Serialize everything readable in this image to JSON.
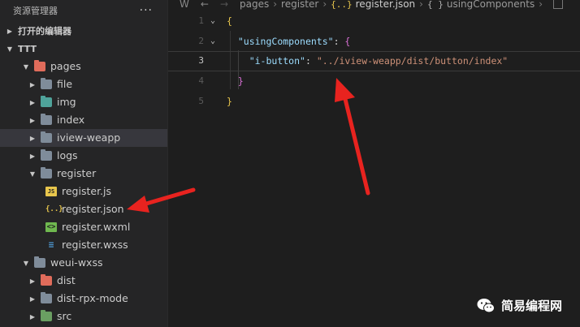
{
  "sidebar": {
    "title": "资源管理器",
    "more_label": "···",
    "open_editors_label": "打开的编辑器",
    "project_label": "TTT"
  },
  "tree": [
    {
      "label": "pages",
      "indent": 1,
      "expanded": true,
      "kind": "folder",
      "icon": "folder-red-icon"
    },
    {
      "label": "file",
      "indent": 2,
      "expanded": false,
      "kind": "folder",
      "icon": "folder-icon"
    },
    {
      "label": "img",
      "indent": 2,
      "expanded": false,
      "kind": "folder",
      "icon": "folder-teal-icon"
    },
    {
      "label": "index",
      "indent": 2,
      "expanded": false,
      "kind": "folder",
      "icon": "folder-icon"
    },
    {
      "label": "iview-weapp",
      "indent": 2,
      "expanded": false,
      "kind": "folder",
      "icon": "folder-icon",
      "selected": true
    },
    {
      "label": "logs",
      "indent": 2,
      "expanded": false,
      "kind": "folder",
      "icon": "folder-icon"
    },
    {
      "label": "register",
      "indent": 2,
      "expanded": true,
      "kind": "folder",
      "icon": "folder-icon"
    },
    {
      "label": "register.js",
      "indent": 3,
      "kind": "file",
      "icon": "js-file-icon",
      "glyph": "JS"
    },
    {
      "label": "register.json",
      "indent": 3,
      "kind": "file",
      "icon": "json-file-icon",
      "glyph": "{..}"
    },
    {
      "label": "register.wxml",
      "indent": 3,
      "kind": "file",
      "icon": "wxml-file-icon",
      "glyph": "<>"
    },
    {
      "label": "register.wxss",
      "indent": 3,
      "kind": "file",
      "icon": "wxss-file-icon",
      "glyph": "≡"
    },
    {
      "label": "weui-wxss",
      "indent": 1,
      "expanded": true,
      "kind": "folder",
      "icon": "folder-icon"
    },
    {
      "label": "dist",
      "indent": 2,
      "expanded": false,
      "kind": "folder",
      "icon": "folder-red-icon"
    },
    {
      "label": "dist-rpx-mode",
      "indent": 2,
      "expanded": false,
      "kind": "folder",
      "icon": "folder-icon"
    },
    {
      "label": "src",
      "indent": 2,
      "expanded": false,
      "kind": "folder",
      "icon": "folder-green-icon"
    }
  ],
  "breadcrumb": {
    "parts": [
      "pages",
      "register",
      "register.json",
      "usingComponents"
    ],
    "json_glyph": "{..}",
    "object_glyph": "{ }"
  },
  "code": {
    "lines": [
      {
        "n": "1",
        "fold": "⌄",
        "tokens": [
          {
            "t": "{",
            "c": "p-brace"
          }
        ]
      },
      {
        "n": "2",
        "fold": "⌄",
        "tokens": [
          {
            "t": "  "
          },
          {
            "t": "\"usingComponents\"",
            "c": "p-key"
          },
          {
            "t": ": ",
            "c": "p-punct"
          },
          {
            "t": "{",
            "c": "p-pink"
          }
        ]
      },
      {
        "n": "3",
        "fold": "",
        "active": true,
        "tokens": [
          {
            "t": "    "
          },
          {
            "t": "\"i-button\"",
            "c": "p-key"
          },
          {
            "t": ": ",
            "c": "p-punct"
          },
          {
            "t": "\"../iview-weapp/dist/button/index\"",
            "c": "p-str"
          }
        ]
      },
      {
        "n": "4",
        "fold": "",
        "tokens": [
          {
            "t": "  "
          },
          {
            "t": "}",
            "c": "p-pink"
          }
        ]
      },
      {
        "n": "5",
        "fold": "",
        "tokens": [
          {
            "t": "}",
            "c": "p-brace"
          }
        ]
      }
    ]
  },
  "watermark": {
    "text": "简易编程网"
  },
  "colors": {
    "arrow": "#e8231f"
  }
}
